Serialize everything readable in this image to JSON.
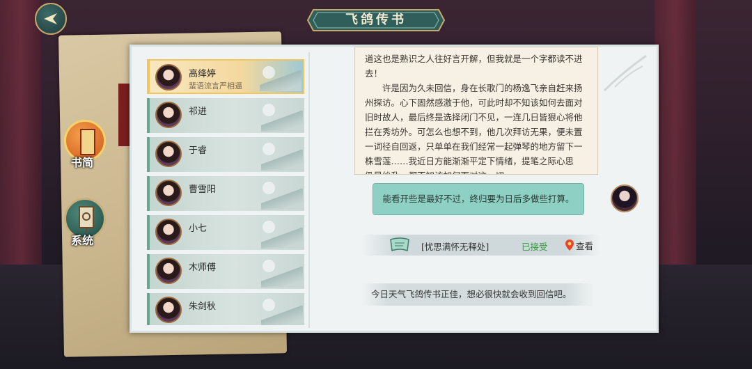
{
  "header": {
    "title": "飞鸽传书"
  },
  "sidebar": {
    "letters_label": "书简",
    "system_label": "系统"
  },
  "contacts": [
    {
      "name": "高绛婷",
      "subtitle": "蜚语流言严相逼",
      "active": true
    },
    {
      "name": "祁进",
      "subtitle": "",
      "active": false
    },
    {
      "name": "于睿",
      "subtitle": "",
      "active": false
    },
    {
      "name": "曹雪阳",
      "subtitle": "",
      "active": false
    },
    {
      "name": "小七",
      "subtitle": "",
      "active": false
    },
    {
      "name": "木师傅",
      "subtitle": "",
      "active": false
    },
    {
      "name": "朱剑秋",
      "subtitle": "",
      "active": false
    }
  ],
  "conversation": {
    "letter_lines": [
      "道这也是熟识之人往好言开解，但我就是一个字都读不进",
      "去！",
      "　　许是因为久未回信，身在长歌门的杨逸飞亲自赶来扬",
      "州探访。心下固然感激于他，可此时却不知该如何去面对",
      "旧时故人，最后终是选择闭门不见，一连几日皆狠心将他",
      "拦在秀坊外。可怎么也想不到，他几次拜访无果，便未置",
      "一词径自回返，只单单在我们经常一起弹琴的地方留下一",
      "株雪莲……我近日方能渐渐平定下情绪，提笔之际心思",
      "仍是纷乱，都不知该如何面对这一切。"
    ],
    "reply": "能看开些是最好不过，终归要为日后多做些打算。",
    "quest": {
      "name": "[忧思满怀无释处]",
      "status": "已接受",
      "view_label": "查看"
    },
    "system_message": "今日天气飞鸽传书正佳，想必很快就会收到回信吧。"
  },
  "colors": {
    "accent_teal": "#8fd0c4",
    "quest_accepted": "#2f9c3a",
    "active_border": "#f2c65b"
  }
}
